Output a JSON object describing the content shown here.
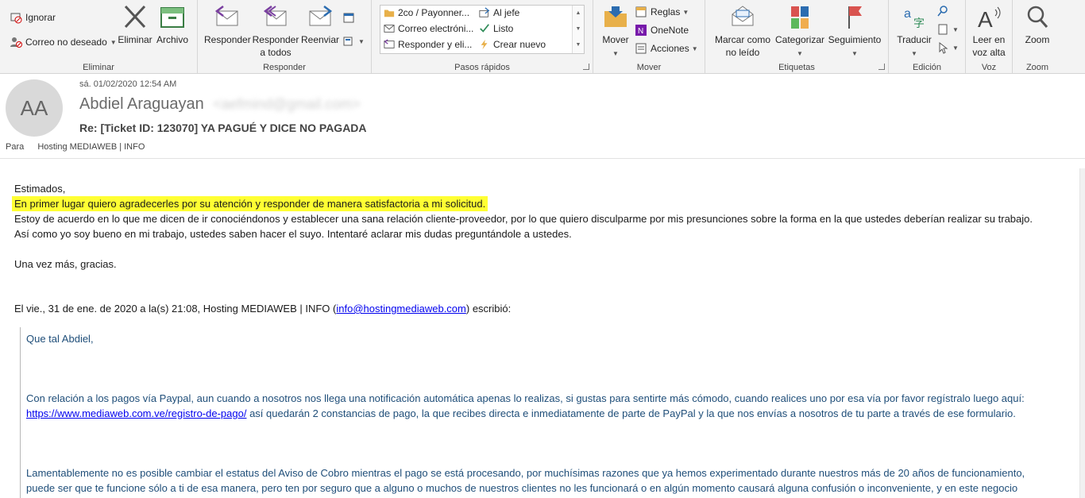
{
  "ribbon": {
    "eliminar_group": {
      "label": "Eliminar",
      "ignorar": "Ignorar",
      "correo_no_deseado": "Correo no deseado",
      "eliminar": "Eliminar",
      "archivo": "Archivo"
    },
    "responder_group": {
      "label": "Responder",
      "responder": "Responder",
      "responder_todos_1": "Responder",
      "responder_todos_2": "a todos",
      "reenviar": "Reenviar"
    },
    "pasos_rapidos": {
      "label": "Pasos rápidos",
      "items": [
        "2co / Payonner...",
        "Al jefe",
        "Correo electróni...",
        "Listo",
        "Responder y eli...",
        "Crear nuevo"
      ]
    },
    "mover_group": {
      "label": "Mover",
      "mover": "Mover",
      "reglas": "Reglas",
      "onenote": "OneNote",
      "acciones": "Acciones"
    },
    "etiquetas_group": {
      "label": "Etiquetas",
      "marcar_1": "Marcar como",
      "marcar_2": "no leído",
      "categorizar": "Categorizar",
      "seguimiento": "Seguimiento"
    },
    "edicion_group": {
      "label": "Edición",
      "traducir": "Traducir"
    },
    "voz_group": {
      "label": "Voz",
      "leer_1": "Leer en",
      "leer_2": "voz alta"
    },
    "zoom_group": {
      "label": "Zoom",
      "zoom": "Zoom"
    }
  },
  "header": {
    "avatar_initials": "AA",
    "date": "sá. 01/02/2020 12:54 AM",
    "sender_name": "Abdiel Araguayan",
    "sender_email": "<aefmind@gmail.com>",
    "subject": "Re: [Ticket ID: 123070] YA PAGUÉ Y DICE NO PAGADA",
    "to_label": "Para",
    "to_value": "Hosting MEDIAWEB | INFO"
  },
  "body": {
    "line1": "Estimados,",
    "line2": "En primer lugar quiero agradecerles por su atención y responder de manera satisfactoria a mi solicitud.",
    "line3": "Estoy de acuerdo en lo que me dicen de ir conociéndonos y establecer una sana relación cliente-proveedor, por lo que quiero disculparme por mis presunciones sobre la forma en la que ustedes deberían realizar su trabajo.",
    "line4": "Así como yo soy bueno en mi trabajo, ustedes saben hacer el suyo. Intentaré aclarar mis dudas preguntándole a ustedes.",
    "line5": "Una vez más, gracias.",
    "quote_header_pre": "El vie., 31 de ene. de 2020 a la(s) 21:08, Hosting MEDIAWEB | INFO (",
    "quote_header_link": "info@hostingmediaweb.com",
    "quote_header_post": ") escribió:"
  },
  "quote": {
    "greeting": "Que tal Abdiel,",
    "p1_line1": "Con relación a los pagos vía Paypal, aun cuando a nosotros nos llega una notificación automática apenas lo realizas, si gustas para sentirte más cómodo, cuando realices uno por esa vía por favor regístralo luego aquí:",
    "p1_link": "https://www.mediaweb.com.ve/registro-de-pago/",
    "p1_line2_rest": " así quedarán 2 constancias de pago, la que recibes directa e inmediatamente de parte de PayPal y la que nos envías a nosotros de tu parte a través de ese formulario.",
    "p2_line1": "Lamentablemente no es posible cambiar el estatus del Aviso de Cobro mientras el pago se está procesando, por muchísimas razones que ya hemos experimentado durante nuestros más de 20 años de funcionamiento,",
    "p2_line2": "puede ser que te funcione sólo a ti de esa manera, pero ten por seguro que a alguno o muchos de nuestros clientes no les funcionará o en algún momento causará alguna confusión o inconveniente, y en este negocio"
  },
  "colors": {
    "highlight": "#ffff33",
    "quote_text": "#1f4e79",
    "link": "#0000ee",
    "accent": "#2b579a"
  }
}
